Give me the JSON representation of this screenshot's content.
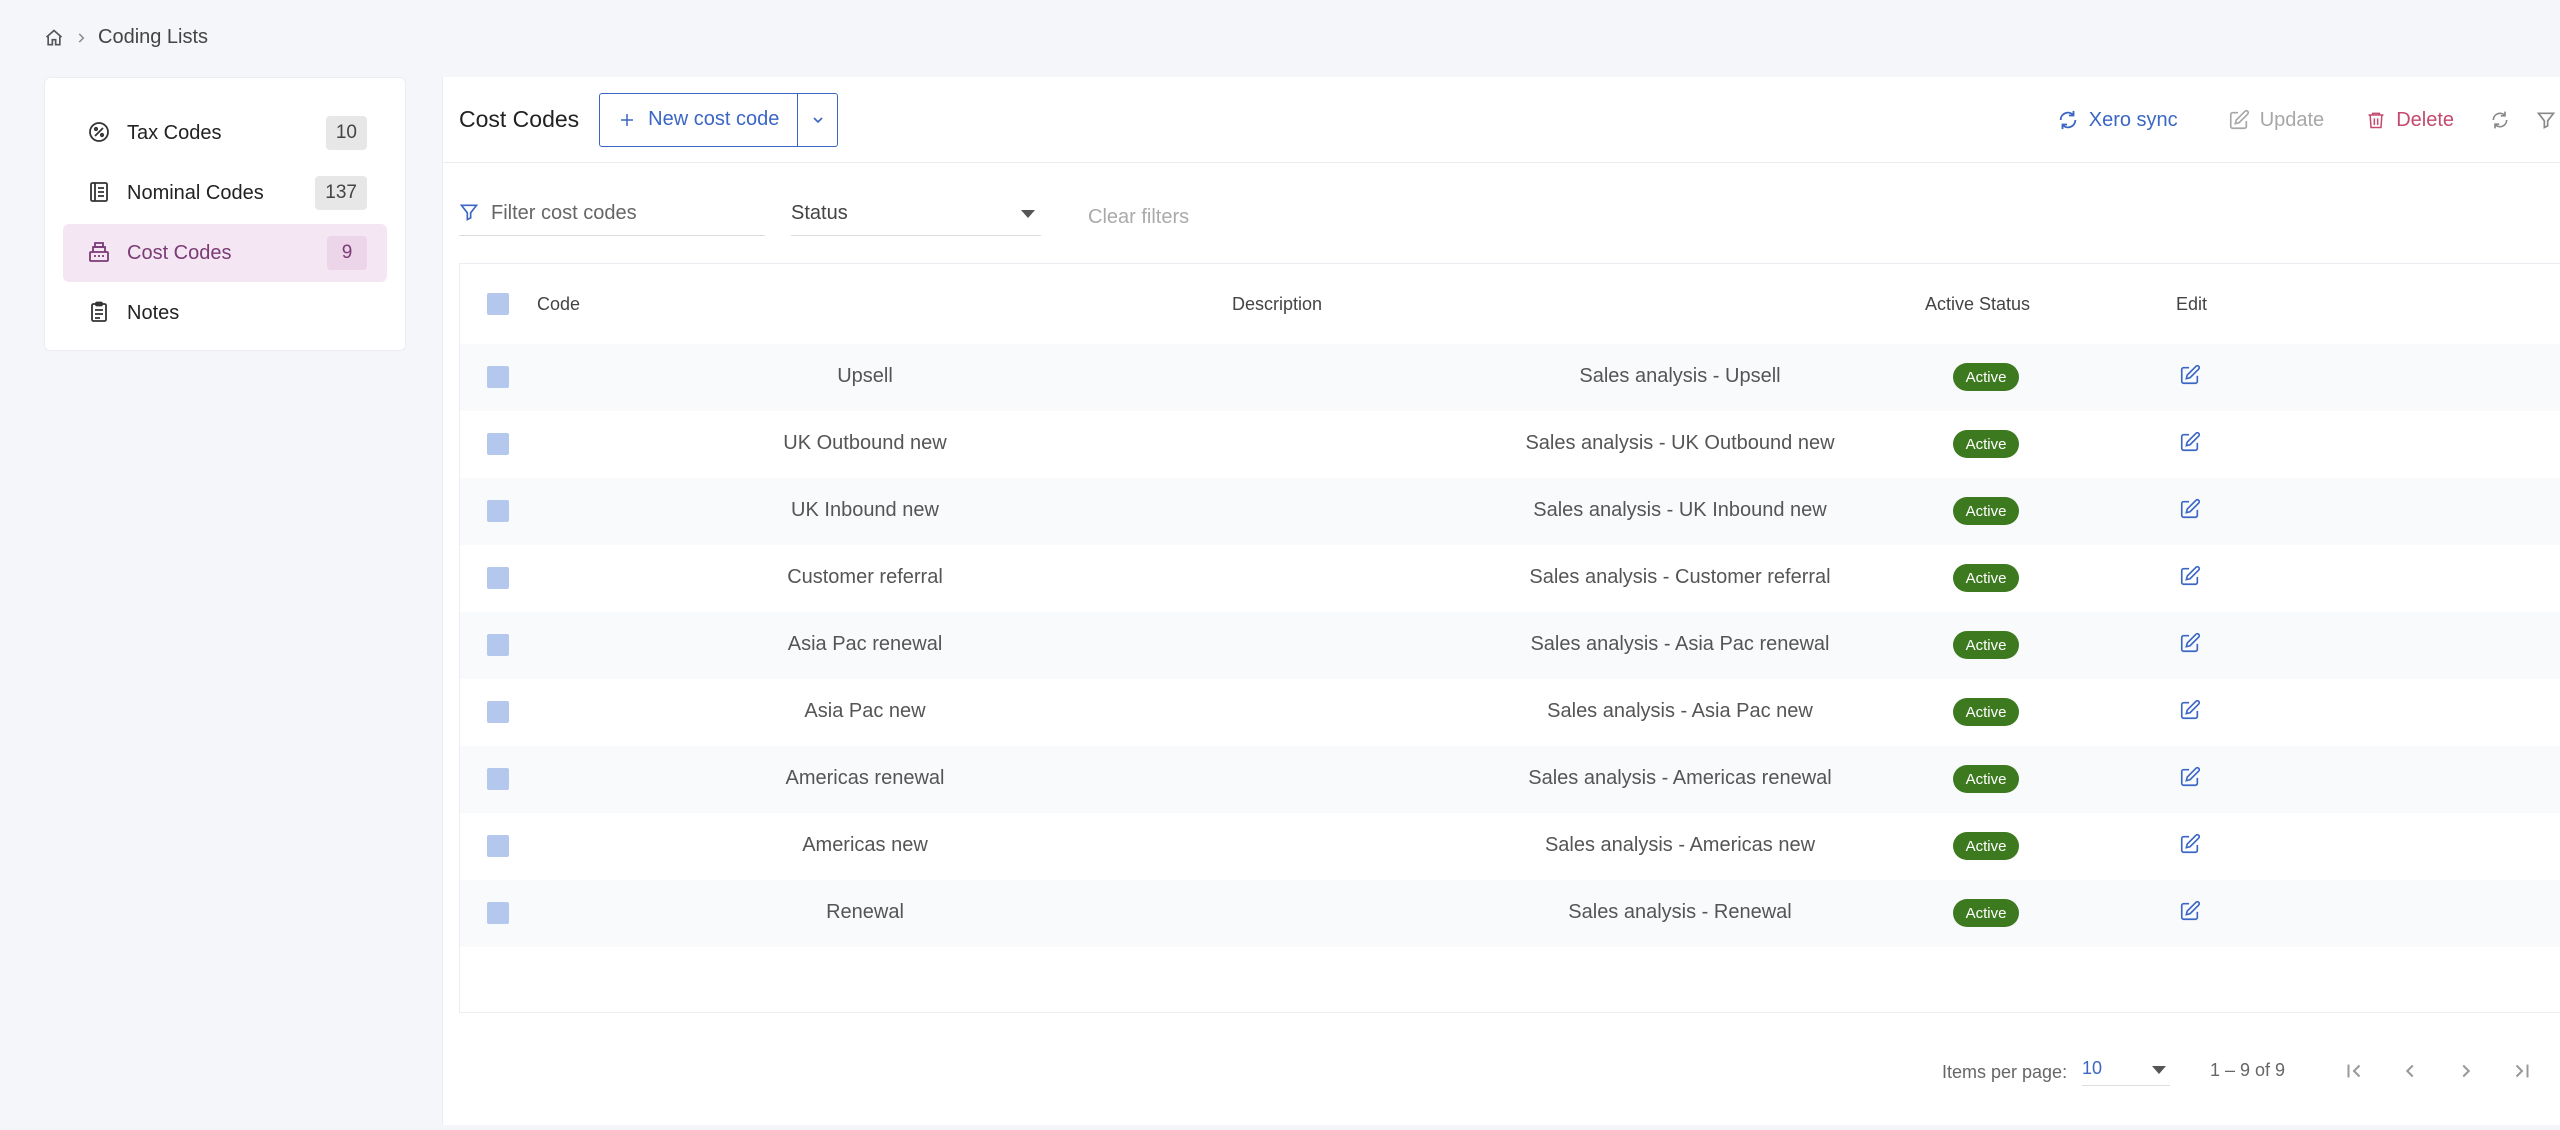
{
  "breadcrumb": {
    "current": "Coding Lists"
  },
  "sidebar": {
    "items": [
      {
        "label": "Tax Codes",
        "count": "10",
        "icon": "tax-icon"
      },
      {
        "label": "Nominal Codes",
        "count": "137",
        "icon": "ledger-icon"
      },
      {
        "label": "Cost Codes",
        "count": "9",
        "icon": "register-icon",
        "active": true
      },
      {
        "label": "Notes",
        "count": "",
        "icon": "clipboard-icon"
      }
    ]
  },
  "toolbar": {
    "title": "Cost Codes",
    "new_label": "New cost code",
    "xero_label": "Xero sync",
    "update_label": "Update",
    "delete_label": "Delete"
  },
  "filters": {
    "placeholder": "Filter cost codes",
    "status_label": "Status",
    "clear_label": "Clear filters"
  },
  "table": {
    "headers": {
      "code": "Code",
      "description": "Description",
      "status": "Active Status",
      "edit": "Edit"
    },
    "rows": [
      {
        "code": "Upsell",
        "description": "Sales analysis - Upsell",
        "status": "Active"
      },
      {
        "code": "UK Outbound new",
        "description": "Sales analysis - UK Outbound new",
        "status": "Active"
      },
      {
        "code": "UK Inbound new",
        "description": "Sales analysis - UK Inbound new",
        "status": "Active"
      },
      {
        "code": "Customer referral",
        "description": "Sales analysis - Customer referral",
        "status": "Active"
      },
      {
        "code": "Asia Pac renewal",
        "description": "Sales analysis - Asia Pac renewal",
        "status": "Active"
      },
      {
        "code": "Asia Pac new",
        "description": "Sales analysis - Asia Pac new",
        "status": "Active"
      },
      {
        "code": "Americas renewal",
        "description": "Sales analysis - Americas renewal",
        "status": "Active"
      },
      {
        "code": "Americas new",
        "description": "Sales analysis - Americas new",
        "status": "Active"
      },
      {
        "code": "Renewal",
        "description": "Sales analysis - Renewal",
        "status": "Active"
      }
    ]
  },
  "paginator": {
    "items_per_page_label": "Items per page:",
    "items_per_page": "10",
    "range": "1 – 9 of 9"
  },
  "colors": {
    "accent": "#3b66c4",
    "active_nav": "#7b3b76",
    "status_active": "#3d7a1f",
    "delete": "#c34a6e"
  }
}
